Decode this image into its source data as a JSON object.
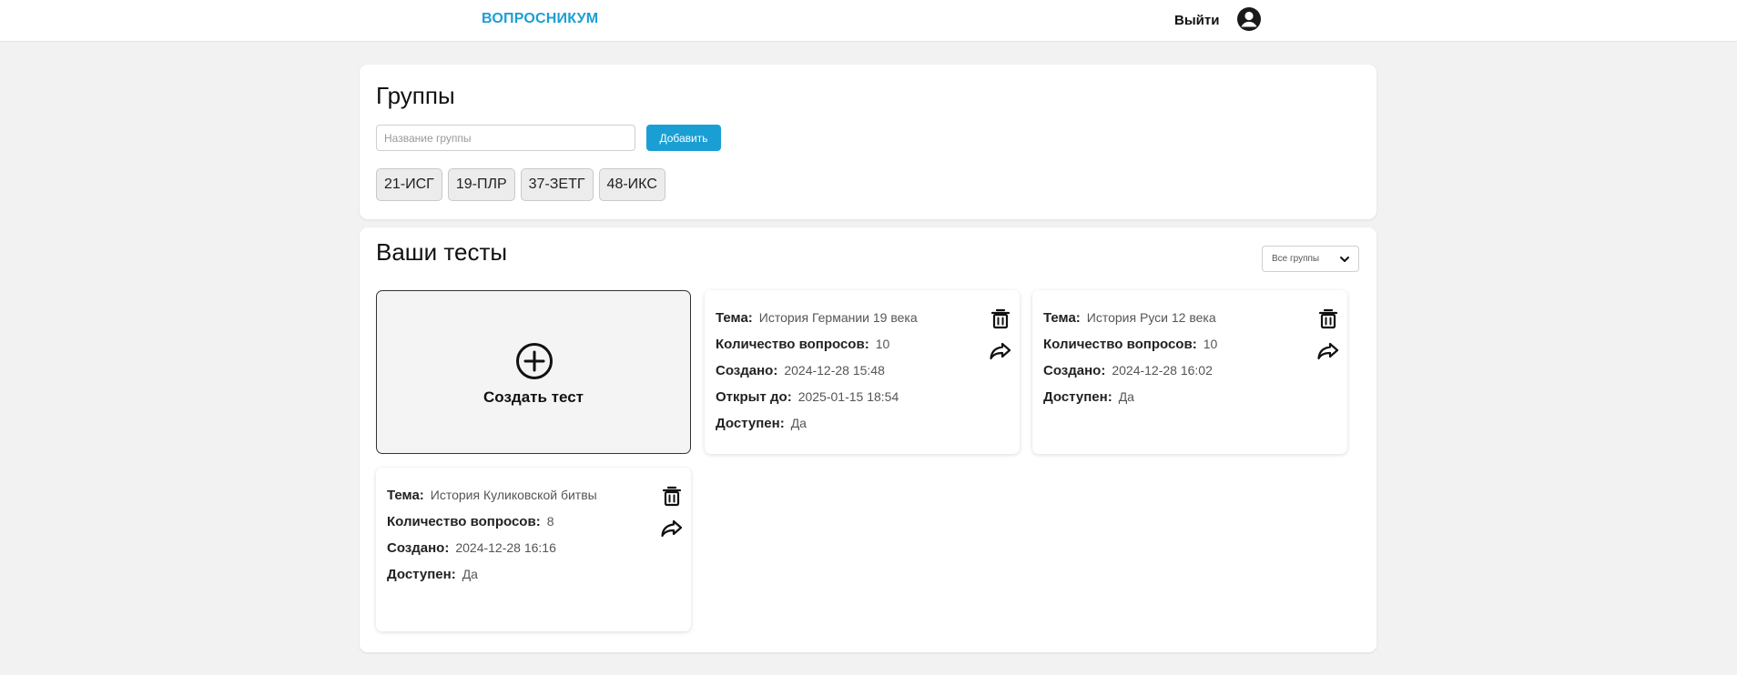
{
  "header": {
    "logo": "ВОПРОСНИКУМ",
    "logout_label": "Выйти",
    "avatar_icon": "user-circle-icon"
  },
  "groups_panel": {
    "title": "Группы",
    "input_placeholder": "Название группы",
    "input_value": "",
    "add_label": "Добавить",
    "groups": [
      "21-ИСГ",
      "19-ПЛР",
      "37-ЗЕТГ",
      "48-ИКС"
    ]
  },
  "tests_panel": {
    "title": "Ваши тесты",
    "group_filter": {
      "selected": "Все группы"
    },
    "create_label": "Создать тест",
    "create_icon": "plus-circle-icon",
    "tests": [
      {
        "fields": [
          {
            "key": "Тема:",
            "value": "История Германии 19 века"
          },
          {
            "key": "Количество вопросов:",
            "value": "10"
          },
          {
            "key": "Создано:",
            "value": "2024-12-28 15:48"
          },
          {
            "key": "Открыт до:",
            "value": "2025-01-15 18:54"
          },
          {
            "key": "Доступен:",
            "value": "Да"
          }
        ]
      },
      {
        "fields": [
          {
            "key": "Тема:",
            "value": "История Руси 12 века"
          },
          {
            "key": "Количество вопросов:",
            "value": "10"
          },
          {
            "key": "Создано:",
            "value": "2024-12-28 16:02"
          },
          {
            "key": "Доступен:",
            "value": "Да"
          }
        ]
      },
      {
        "fields": [
          {
            "key": "Тема:",
            "value": "История Куликовской битвы"
          },
          {
            "key": "Количество вопросов:",
            "value": "8"
          },
          {
            "key": "Создано:",
            "value": "2024-12-28 16:16"
          },
          {
            "key": "Доступен:",
            "value": "Да"
          }
        ]
      }
    ]
  },
  "colors": {
    "accent": "#1a9fd4",
    "background": "#f2f2f2",
    "panel": "#ffffff"
  }
}
